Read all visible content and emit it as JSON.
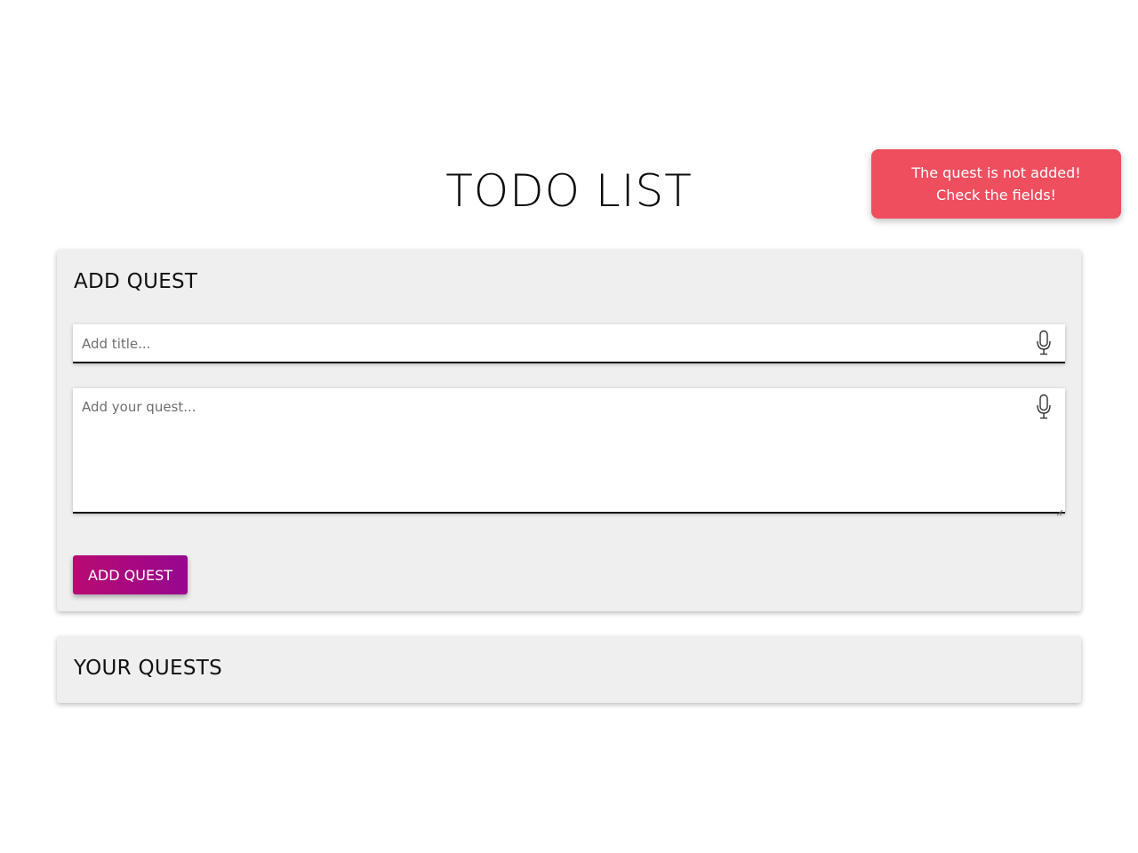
{
  "page": {
    "title": "TODO LIST"
  },
  "toast": {
    "line1": "The quest is not added!",
    "line2": "Check the fields!",
    "color": "#ef4e5f"
  },
  "add_panel": {
    "heading": "ADD QUEST",
    "title_input": {
      "value": "",
      "placeholder": "Add title...",
      "icon": "microphone-icon"
    },
    "quest_input": {
      "value": "",
      "placeholder": "Add your quest...",
      "icon": "microphone-icon"
    },
    "submit_label": "ADD QUEST",
    "button_colors": [
      "#b80b72",
      "#97078f"
    ]
  },
  "list_panel": {
    "heading": "YOUR QUESTS",
    "items": []
  }
}
